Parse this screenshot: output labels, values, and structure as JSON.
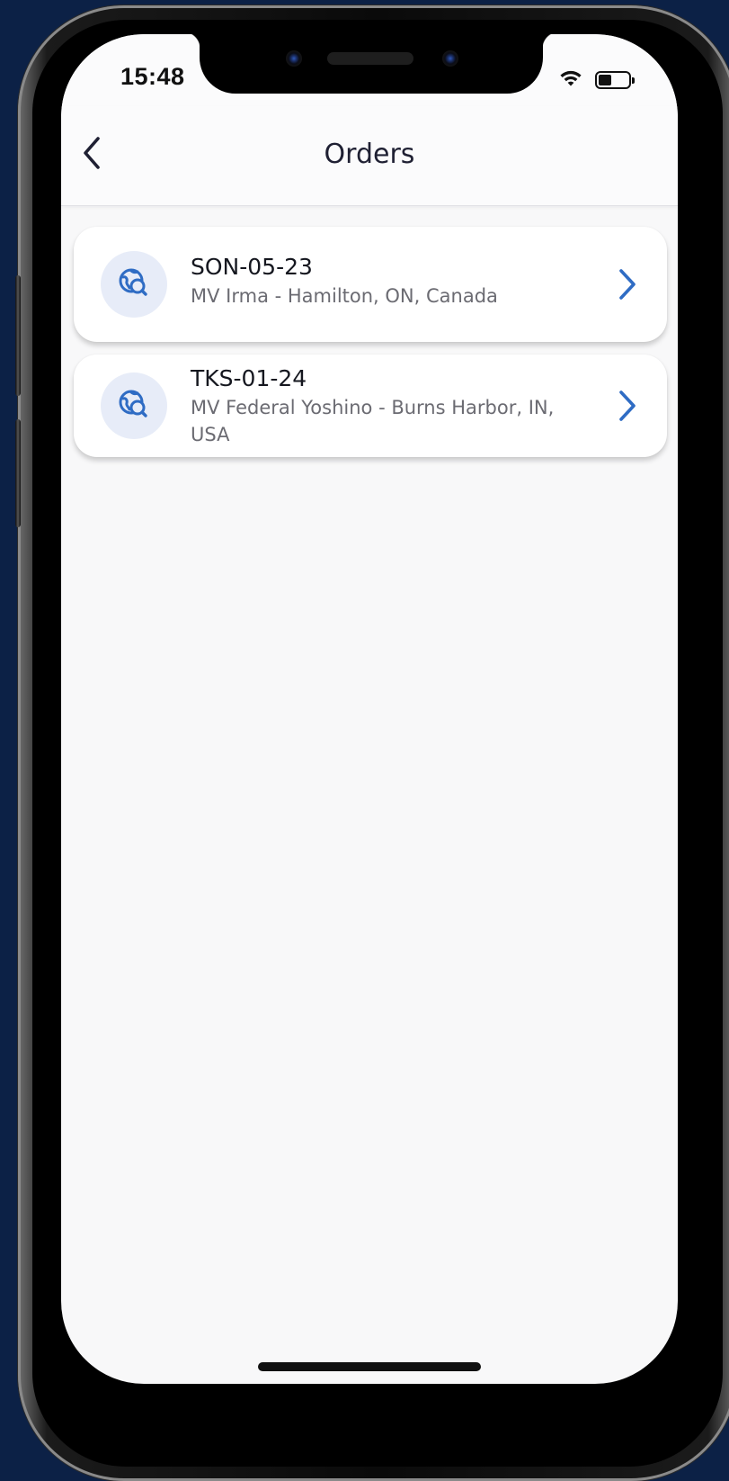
{
  "status_bar": {
    "time": "15:48",
    "wifi_icon": "wifi-icon",
    "battery_icon": "battery-icon"
  },
  "header": {
    "title": "Orders",
    "back_icon": "chevron-left-icon"
  },
  "orders": [
    {
      "id": "SON-05-23",
      "description": "MV Irma - Hamilton, ON, Canada",
      "icon": "globe-search-icon"
    },
    {
      "id": "TKS-01-24",
      "description": "MV Federal Yoshino - Burns Harbor, IN, USA",
      "icon": "globe-search-icon"
    }
  ],
  "colors": {
    "accent": "#2f6cc4",
    "icon_bg": "#e7ecf8",
    "background": "#f8f8f9",
    "frame_bg": "#0c2146"
  }
}
